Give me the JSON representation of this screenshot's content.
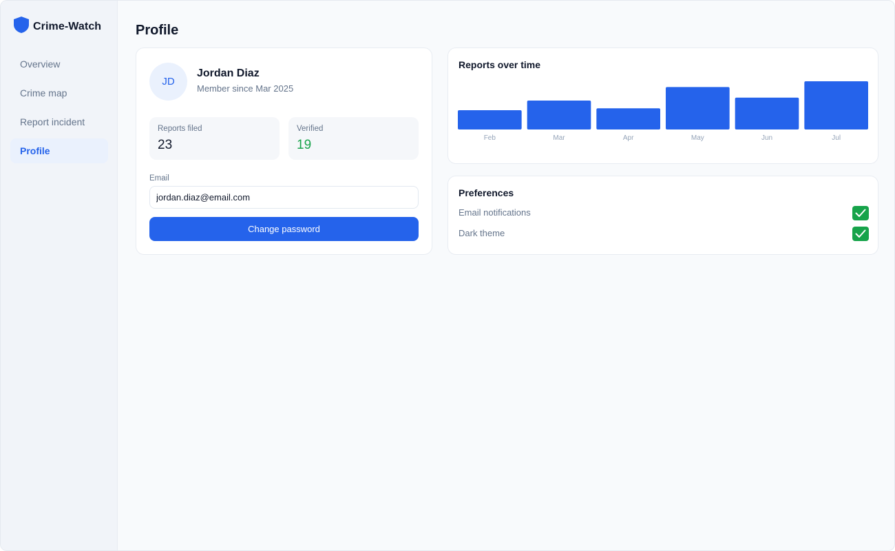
{
  "app": {
    "brand": "Crime-Watch",
    "brand_icon": "shield-icon",
    "accent": "#2563eb",
    "success": "#16a34a"
  },
  "sidebar": {
    "items": [
      {
        "label": "Overview",
        "active": false
      },
      {
        "label": "Crime map",
        "active": false
      },
      {
        "label": "Report incident",
        "active": false
      },
      {
        "label": "Profile",
        "active": true
      }
    ]
  },
  "page": {
    "title": "Profile"
  },
  "profile": {
    "initials": "JD",
    "name": "Jordan Diaz",
    "member_since": "Member since Mar 2025",
    "stats": {
      "reports_label": "Reports filed",
      "reports_value": "23",
      "verified_label": "Verified",
      "verified_value": "19"
    },
    "email_label": "Email",
    "email_value": "jordan.diaz@email.com",
    "change_password_label": "Change password"
  },
  "reports_chart": {
    "title": "Reports over time"
  },
  "chart_data": {
    "type": "bar",
    "title": "Reports over time",
    "categories": [
      "Feb",
      "Mar",
      "Apr",
      "May",
      "Jun",
      "Jul"
    ],
    "values": [
      2,
      3,
      2.2,
      4.4,
      3.3,
      5
    ],
    "ylim": [
      0,
      5
    ],
    "grid": false,
    "color": "#2563eb"
  },
  "preferences": {
    "title": "Preferences",
    "items": [
      {
        "label": "Email notifications",
        "checked": true
      },
      {
        "label": "Dark theme",
        "checked": true
      }
    ]
  }
}
